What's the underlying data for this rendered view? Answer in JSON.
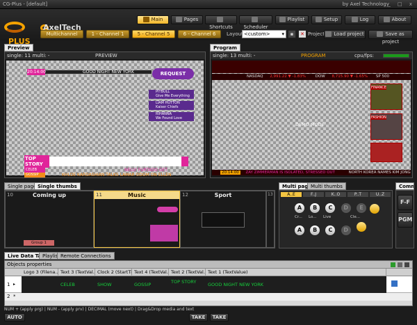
{
  "window": {
    "title": "CG-Plus - [default]",
    "company": "by Axel Technology",
    "controls": "_ □ x"
  },
  "brand": {
    "plus": "PLUS",
    "axel": "AxelTech"
  },
  "nav": {
    "main": "Main",
    "pages": "Pages",
    "shortcuts": "Shortcuts",
    "scheduler": "Scheduler",
    "playlist": "Playlist",
    "setup": "Setup",
    "log": "Log",
    "about": "About"
  },
  "channels": [
    "Multichannel",
    "1 - Channel 1",
    "5 - Channel 5",
    "6 - Channel 6"
  ],
  "layout": {
    "label": "Layout",
    "value": "<custom>",
    "project_label": "Project",
    "load": "Load project",
    "save": "Save as project"
  },
  "preview": {
    "panel": "Preview",
    "info": "single: 11 multi: -",
    "title": "PREVIEW",
    "clock": "20:14:00",
    "headline": "GOOD NIGHT NEW YORK",
    "request": "REQUEST",
    "top_story": "TOP STORY",
    "celeb": "CELEB",
    "nelly": "NELLY FURTADO GET",
    "khloe": "KHLOE KARDASHIAN TALKS LAMAR ODOM ON ELLEN",
    "gossip": "GOSSIP",
    "votes": [
      "PITBULL",
      "LIAM HUTTON",
      "RIHANNA"
    ],
    "vote_sub": [
      "Give Me Everything",
      "Kaiser Chiefs",
      "We Found Love"
    ]
  },
  "program": {
    "panel": "Program",
    "info": "single: 13 multi: -",
    "title": "PROGRAM",
    "cpu": "cpu/fps:",
    "demo": "DEMO MODE",
    "ticker": [
      "NASDAQ",
      "2,991.22 ▼ -1.83%",
      "DOW",
      "8,715.90 ▼ -1.65%",
      "SP 500"
    ],
    "clock": "20:14:00",
    "crawl": "ZAY ZIMMERMAN IS ISOLATED, STRESSED OUT",
    "korea": "NORTH KOREA NAMES KIM JONG",
    "story": "FINANCE",
    "fashion": "FASHION"
  },
  "pages_tabs": [
    "Single pages",
    "Single thumbs"
  ],
  "thumbs": [
    {
      "num": "10",
      "title": "Coming up",
      "group": "Group 1"
    },
    {
      "num": "11",
      "title": "Music"
    },
    {
      "num": "12",
      "title": "Sport"
    },
    {
      "num": "13",
      "title": ""
    }
  ],
  "multi_tabs": [
    "Multi pages",
    "Multi thumbs"
  ],
  "multi_groups": [
    "A..E",
    "F..J",
    "K..O",
    "P..T",
    "U..Z"
  ],
  "letters": [
    "A",
    "B",
    "C",
    "D",
    "E"
  ],
  "row1_labels": [
    "Cr...",
    "Lo...",
    "Live",
    "",
    "Cle..."
  ],
  "commands": {
    "title": "Comma",
    "ff": "F-F",
    "pgm": "PGM"
  },
  "bottom_tabs": [
    "Live Data Tags",
    "Playlist",
    "Remote Connections"
  ],
  "objects": {
    "title": "Objects properties",
    "columns": [
      "Logo 3 (Filena...",
      "Text 3 (TextVal...",
      "Clock 2 (StartTi...",
      "Text 4 (TextVal...",
      "Text 2 (TextVal...",
      "Text 1 (TextValue)"
    ],
    "row1": {
      "num": "1",
      "c1": "",
      "c2": "CELEB",
      "c3": "SHOW",
      "c4": "GOSSIP",
      "c5": "TOP STORY",
      "c6": "GOOD NIGHT NEW YORK"
    },
    "row2": {
      "num": "2"
    }
  },
  "status": {
    "hint": "NUM + (apply prg) | NUM - (apply prv) | DECIMAL (move next) | Drag&Drop media and text",
    "auto": "AUTO",
    "take1": "TAKE",
    "take2": "TAKE"
  }
}
